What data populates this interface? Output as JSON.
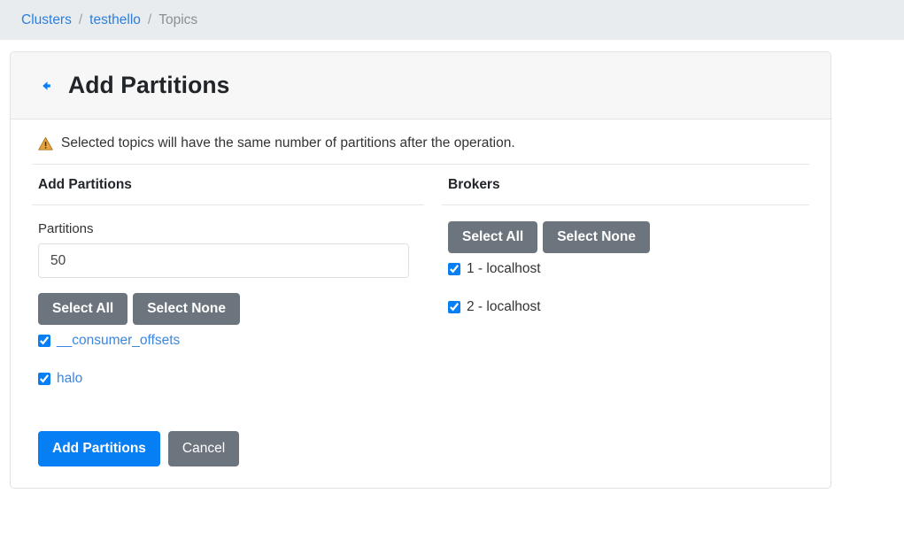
{
  "breadcrumb": {
    "items": [
      {
        "label": "Clusters",
        "type": "link"
      },
      {
        "label": "testhello",
        "type": "link"
      },
      {
        "label": "Topics",
        "type": "current"
      }
    ],
    "separator": "/"
  },
  "card": {
    "back_icon": "back-arrow-icon",
    "title": "Add Partitions"
  },
  "warning": {
    "icon": "warning-triangle-icon",
    "text": "Selected topics will have the same number of partitions after the operation."
  },
  "partitions_section": {
    "heading": "Add Partitions",
    "field_label": "Partitions",
    "field_value": "50",
    "field_placeholder": "",
    "select_all_label": "Select All",
    "select_none_label": "Select None",
    "topics": [
      {
        "label": "__consumer_offsets",
        "checked": true
      },
      {
        "label": "halo",
        "checked": true
      }
    ]
  },
  "brokers_section": {
    "heading": "Brokers",
    "select_all_label": "Select All",
    "select_none_label": "Select None",
    "brokers": [
      {
        "label": "1 - localhost",
        "checked": true
      },
      {
        "label": "2 - localhost",
        "checked": true
      }
    ]
  },
  "actions": {
    "submit_label": "Add Partitions",
    "cancel_label": "Cancel"
  },
  "colors": {
    "primary": "#067ef4",
    "secondary": "#6c757d",
    "link": "#2a7fdd",
    "breadcrumb_bg": "#e9ecef",
    "header_bg": "#f7f7f7",
    "warning": "#e8a33d"
  }
}
